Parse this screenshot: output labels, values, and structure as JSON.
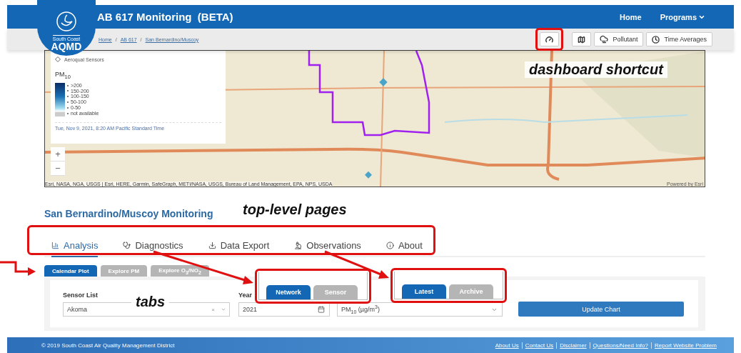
{
  "header": {
    "title": "AB 617 Monitoring  (BETA)",
    "logo": {
      "line1": "South Coast",
      "line2": "AQMD"
    },
    "nav": [
      {
        "label": "Home",
        "dropdown": false
      },
      {
        "label": "Programs",
        "dropdown": true
      }
    ]
  },
  "breadcrumb": {
    "separator": "/",
    "items": [
      "Home",
      "AB 617",
      "San Bernardino/Muscoy"
    ]
  },
  "toolbar": [
    {
      "kind": "icon",
      "annotated": true
    },
    {
      "kind": "icon",
      "annotated": false
    },
    {
      "kind": "labeled",
      "label": "Pollutant",
      "annotated": false
    },
    {
      "kind": "labeled",
      "label": "Time Averages",
      "annotated": false
    }
  ],
  "map": {
    "legend": {
      "sensor_label": "Aeroqual Sensors",
      "pm_title": "PM$_{10}$",
      "scale": [
        ">200",
        "150-200",
        "100-150",
        "50-100",
        "0-50",
        "not available"
      ],
      "timestamp": "Tue, Nov 9, 2021, 8:20 AM Pacific Standard Time"
    },
    "zoom": [
      "+",
      "−"
    ],
    "attribution": "Esri, NASA, NGA, USGS | Esri, HERE, Garmin, SafeGraph, METI/NASA, USGS, Bureau of Land Management, EPA, NPS, USDA",
    "powered_by": "Powered by Esri"
  },
  "page_title": "San Bernardino/Muscoy Monitoring",
  "main_tabs_annotated": true,
  "main_tabs": [
    {
      "label": "Analysis",
      "selected": true
    },
    {
      "label": "Diagnostics",
      "selected": false
    },
    {
      "label": "Data Export",
      "selected": false
    },
    {
      "label": "Observations",
      "selected": false
    },
    {
      "label": "About",
      "selected": false
    }
  ],
  "sub_tabs": [
    {
      "label": "Calendar Plot",
      "selected": true
    },
    {
      "label": "Explore PM",
      "selected": false
    },
    {
      "label": "Explore O$_{3}$/NO$_{2}$",
      "selected": false
    }
  ],
  "form": {
    "sensor_list": {
      "label": "Sensor List",
      "value": "Akoma",
      "clear": "×"
    },
    "year": {
      "label": "Year",
      "value": "2021"
    },
    "pollutant": {
      "value": "PM$_{10}$ (µg/m$^{3}$)"
    },
    "update_button": "Update Chart"
  },
  "footer": {
    "copyright": "© 2019 South Coast Air Quality Management District",
    "links": [
      "About Us",
      "Contact Us",
      "Disclaimer",
      "Questions/Need Info?",
      "Report Website Problem"
    ]
  },
  "annotations": [
    {
      "kind": "label",
      "text": "dashboard shortcut"
    },
    {
      "kind": "label",
      "text": "top-level pages"
    },
    {
      "kind": "label",
      "text": "tabs"
    }
  ],
  "callouts": [
    {
      "tabs": [
        {
          "label": "Network",
          "selected": true
        },
        {
          "label": "Sensor",
          "selected": false
        }
      ]
    },
    {
      "tabs": [
        {
          "label": "Latest",
          "selected": true
        },
        {
          "label": "Archive",
          "selected": false
        }
      ]
    }
  ]
}
